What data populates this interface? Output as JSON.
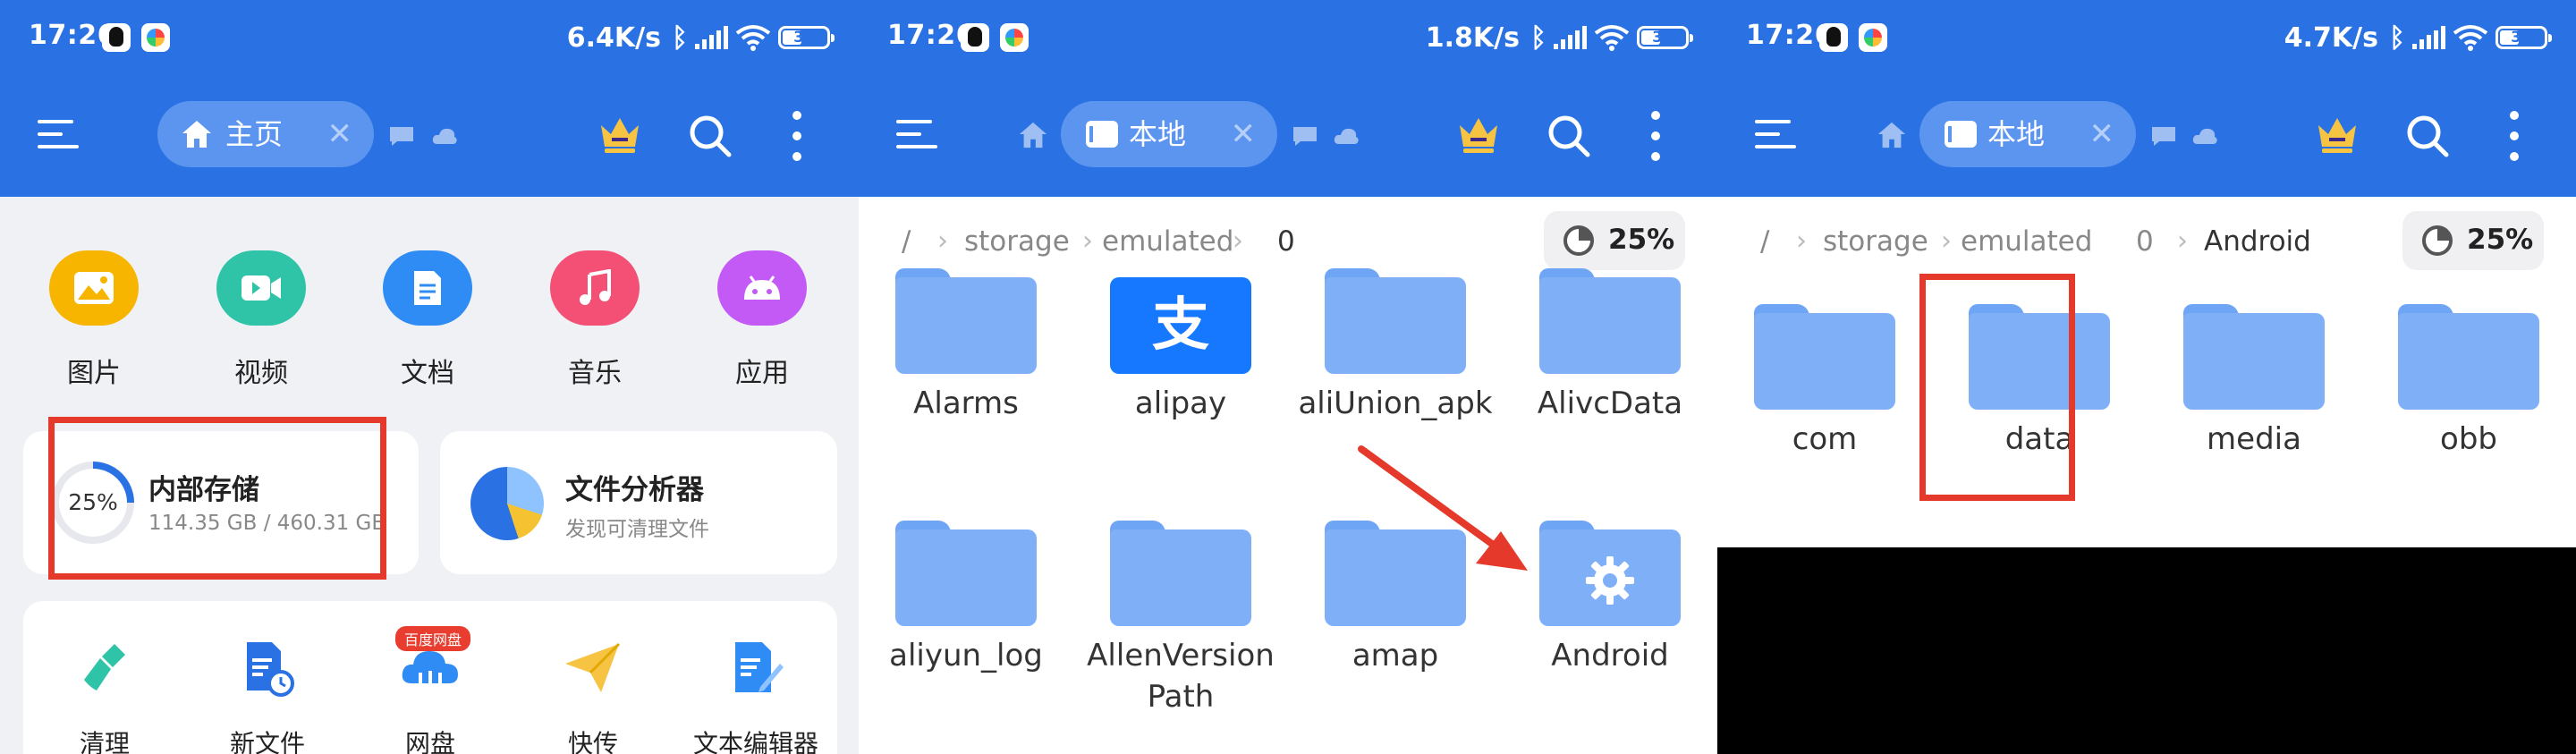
{
  "colors": {
    "primary": "#2a72e4",
    "highlight": "#e53a2b",
    "folder": "#7fb0f7"
  },
  "panels": [
    {
      "status": {
        "time": "17:26",
        "speed": "6.4K/s",
        "battery": "39"
      },
      "tab": {
        "label": "主页",
        "icon": "home-icon"
      },
      "categories": [
        {
          "label": "图片",
          "icon": "image-icon",
          "color": "#f7b500"
        },
        {
          "label": "视频",
          "icon": "video-icon",
          "color": "#2fc4a8"
        },
        {
          "label": "文档",
          "icon": "document-icon",
          "color": "#2f8cf5"
        },
        {
          "label": "音乐",
          "icon": "music-icon",
          "color": "#f44f74"
        },
        {
          "label": "应用",
          "icon": "android-icon",
          "color": "#c35af5"
        }
      ],
      "storage": {
        "title": "内部存储",
        "usage": "114.35 GB / 460.31 GB",
        "percent_label": "25%",
        "percent": 25
      },
      "analyzer": {
        "title": "文件分析器",
        "subtitle": "发现可清理文件"
      },
      "tools": [
        {
          "label": "清理",
          "icon": "broom-icon"
        },
        {
          "label": "新文件",
          "icon": "new-file-icon"
        },
        {
          "label": "网盘",
          "icon": "cloud-drive-icon",
          "badge": "百度网盘"
        },
        {
          "label": "快传",
          "icon": "paper-plane-icon"
        },
        {
          "label": "文本编辑器",
          "icon": "text-editor-icon"
        }
      ]
    },
    {
      "status": {
        "time": "17:26",
        "speed": "1.8K/s",
        "battery": "39"
      },
      "tab": {
        "label": "本地",
        "icon": "local-storage-icon"
      },
      "breadcrumb": [
        "/",
        "storage",
        "emulated",
        "0"
      ],
      "usage_label": "25%",
      "folders": [
        "Alarms",
        "alipay",
        "aliUnion_apk",
        "AlivcData",
        "aliyun_log",
        "AllenVersionPath",
        "amap",
        "Android"
      ]
    },
    {
      "status": {
        "time": "17:26",
        "speed": "4.7K/s",
        "battery": "39"
      },
      "tab": {
        "label": "本地",
        "icon": "local-storage-icon"
      },
      "breadcrumb": [
        "/",
        "storage",
        "emulated",
        "0",
        "Android"
      ],
      "usage_label": "25%",
      "folders": [
        "com",
        "data",
        "media",
        "obb"
      ]
    }
  ]
}
